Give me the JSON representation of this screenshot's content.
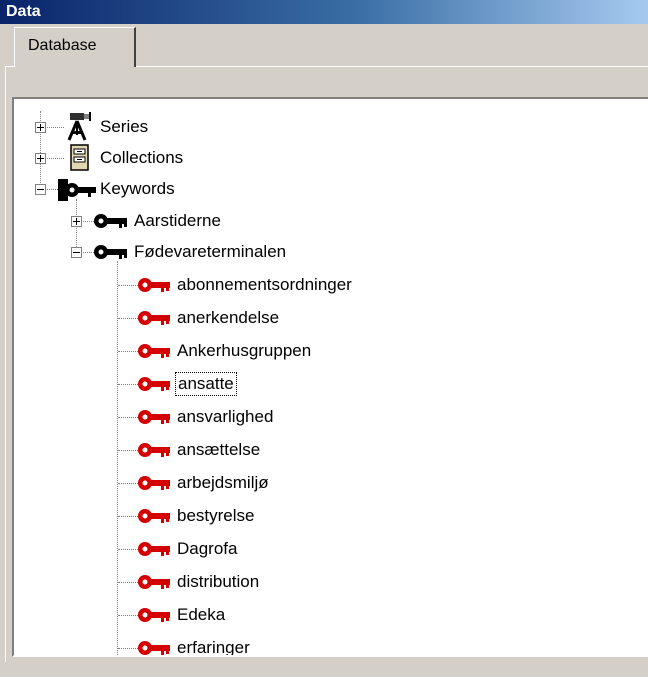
{
  "window": {
    "title": "Data"
  },
  "tabs": [
    {
      "label": "Database",
      "selected": true
    }
  ],
  "tree": {
    "roots": [
      {
        "label": "Series",
        "icon": "camera-stand-icon",
        "expanded": false
      },
      {
        "label": "Collections",
        "icon": "file-cabinet-icon",
        "expanded": false
      },
      {
        "label": "Keywords",
        "icon": "key-black-icon",
        "expanded": true,
        "children": [
          {
            "label": "Aarstiderne",
            "icon": "key-black-icon",
            "expanded": false
          },
          {
            "label": "Fødevareterminalen",
            "icon": "key-black-icon",
            "expanded": true,
            "children": [
              {
                "label": "abonnementsordninger",
                "icon": "key-red-icon"
              },
              {
                "label": "anerkendelse",
                "icon": "key-red-icon"
              },
              {
                "label": "Ankerhusgruppen",
                "icon": "key-red-icon"
              },
              {
                "label": "ansatte",
                "icon": "key-red-icon",
                "focused": true
              },
              {
                "label": "ansvarlighed",
                "icon": "key-red-icon"
              },
              {
                "label": "ansættelse",
                "icon": "key-red-icon"
              },
              {
                "label": "arbejdsmiljø",
                "icon": "key-red-icon"
              },
              {
                "label": "bestyrelse",
                "icon": "key-red-icon"
              },
              {
                "label": "Dagrofa",
                "icon": "key-red-icon"
              },
              {
                "label": "distribution",
                "icon": "key-red-icon"
              },
              {
                "label": "Edeka",
                "icon": "key-red-icon"
              },
              {
                "label": "erfaringer",
                "icon": "key-red-icon"
              }
            ]
          }
        ]
      }
    ]
  },
  "colors": {
    "key_red": "#d40000",
    "key_black": "#000000",
    "title_bar": "#0a246a"
  }
}
